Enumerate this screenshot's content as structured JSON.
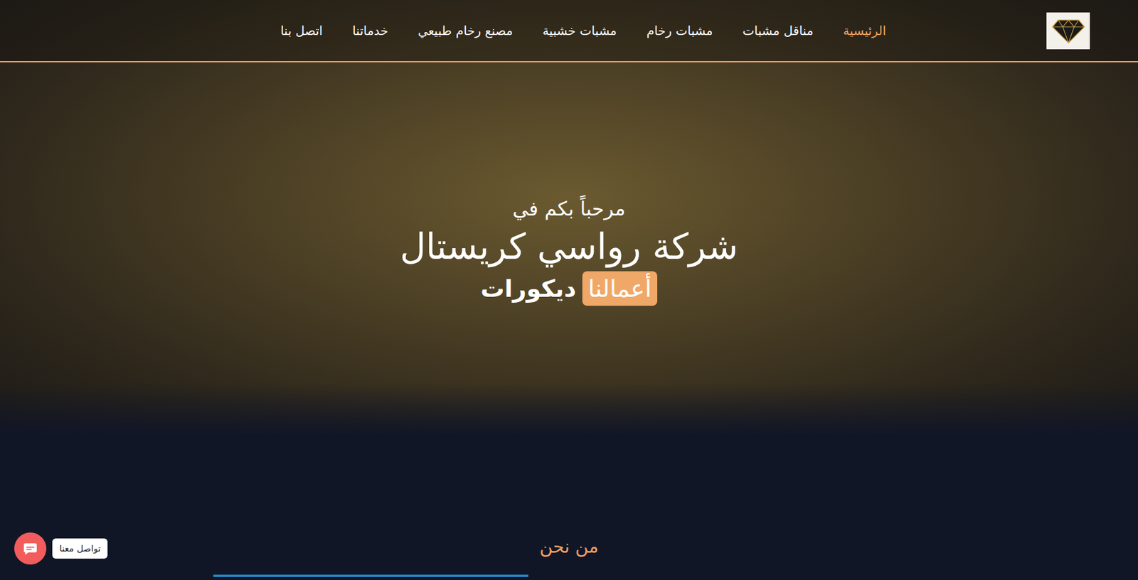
{
  "nav": {
    "items": [
      {
        "label": "الرئيسية",
        "selected": true
      },
      {
        "label": "مناقل مشبات",
        "selected": false
      },
      {
        "label": "مشبات رخام",
        "selected": false
      },
      {
        "label": "مشبات خشبية",
        "selected": false
      },
      {
        "label": "مصنع رخام طبيعي",
        "selected": false
      },
      {
        "label": "خدماتنا",
        "selected": false
      },
      {
        "label": "اتصل بنا",
        "selected": false
      }
    ]
  },
  "hero": {
    "greeting": "مرحباً بكم في",
    "title": "شركة رواسي كريستال",
    "badge": "أعمالنا",
    "word": "ديكورات"
  },
  "about": {
    "title": "من نحن"
  },
  "chat": {
    "label": "تواصل معنا"
  }
}
